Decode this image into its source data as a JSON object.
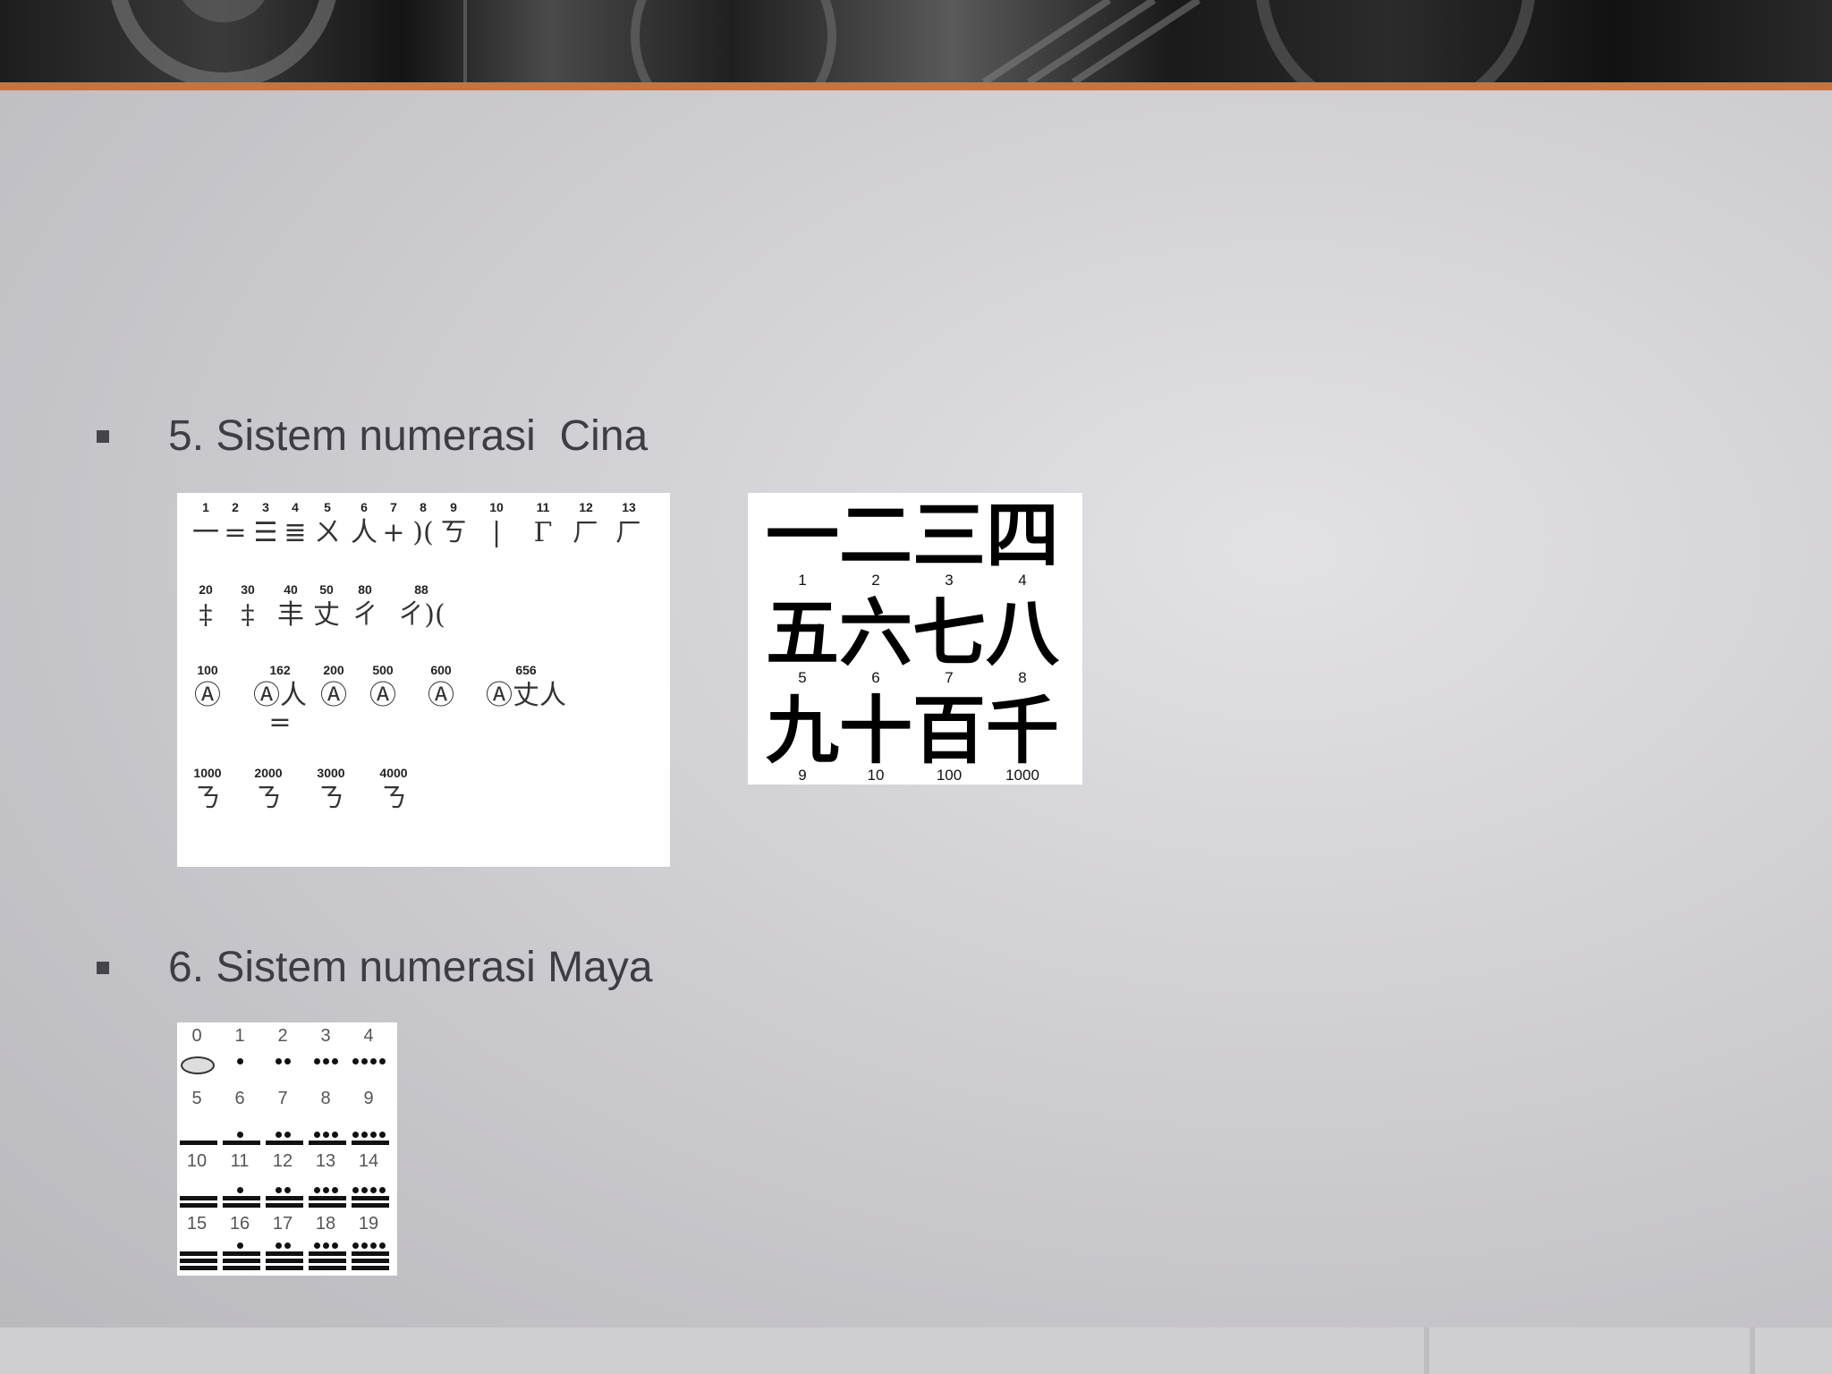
{
  "slide": {
    "bullets": [
      {
        "text": "5. Sistem numerasi  Cina"
      },
      {
        "text": "6. Sistem numerasi Maya"
      }
    ]
  },
  "cina_rod_table": {
    "rows": [
      [
        {
          "n": "1",
          "g": "一"
        },
        {
          "n": "2",
          "g": "="
        },
        {
          "n": "3",
          "g": "☰"
        },
        {
          "n": "4",
          "g": "≣"
        },
        {
          "n": "5",
          "g": "ㄨ"
        },
        {
          "n": "6",
          "g": "⼈"
        },
        {
          "n": "7",
          "g": "+"
        },
        {
          "n": "8",
          "g": ")("
        },
        {
          "n": "9",
          "g": "ㄎ"
        },
        {
          "n": "10",
          "g": "|"
        },
        {
          "n": "11",
          "g": "Γ"
        },
        {
          "n": "12",
          "g": "ㄏ"
        },
        {
          "n": "13",
          "g": "ㄏ"
        }
      ],
      [
        {
          "n": "20",
          "g": "‡"
        },
        {
          "n": "30",
          "g": "‡"
        },
        {
          "n": "40",
          "g": "丰"
        },
        {
          "n": "50",
          "g": "丈"
        },
        {
          "n": "80",
          "g": "ㄔ"
        },
        {
          "n": "88",
          "g": "ㄔ)("
        }
      ],
      [
        {
          "n": "100",
          "g": "Ⓐ"
        },
        {
          "n": "162",
          "g": "Ⓐ⼈="
        },
        {
          "n": "200",
          "g": "Ⓐ"
        },
        {
          "n": "500",
          "g": "Ⓐ"
        },
        {
          "n": "600",
          "g": "Ⓐ"
        },
        {
          "n": "656",
          "g": "Ⓐ丈⼈"
        }
      ],
      [
        {
          "n": "1000",
          "g": "ㄋ"
        },
        {
          "n": "2000",
          "g": "ㄋ"
        },
        {
          "n": "3000",
          "g": "ㄋ"
        },
        {
          "n": "4000",
          "g": "ㄋ"
        }
      ]
    ]
  },
  "cina_han_table": {
    "cells": [
      {
        "h": "一",
        "n": "1"
      },
      {
        "h": "二",
        "n": "2"
      },
      {
        "h": "三",
        "n": "3"
      },
      {
        "h": "四",
        "n": "4"
      },
      {
        "h": "五",
        "n": "5"
      },
      {
        "h": "六",
        "n": "6"
      },
      {
        "h": "七",
        "n": "7"
      },
      {
        "h": "八",
        "n": "8"
      },
      {
        "h": "九",
        "n": "9"
      },
      {
        "h": "十",
        "n": "10"
      },
      {
        "h": "百",
        "n": "100"
      },
      {
        "h": "千",
        "n": "1000"
      }
    ]
  },
  "maya_table": {
    "numbers": [
      "0",
      "1",
      "2",
      "3",
      "4",
      "5",
      "6",
      "7",
      "8",
      "9",
      "10",
      "11",
      "12",
      "13",
      "14",
      "15",
      "16",
      "17",
      "18",
      "19"
    ]
  },
  "colors": {
    "accent": "#c6743f",
    "text": "#3e3d44"
  }
}
